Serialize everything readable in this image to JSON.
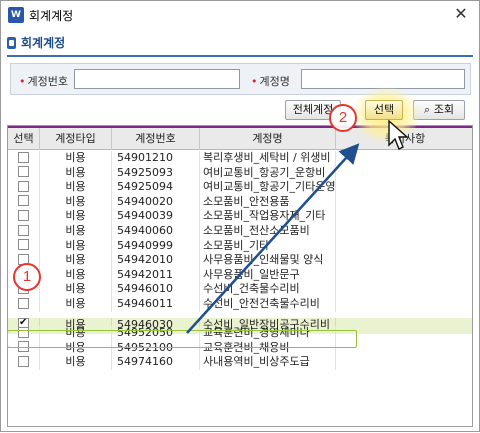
{
  "window": {
    "title": "회계계정",
    "icon_label": "W"
  },
  "page": {
    "heading": "회계계정"
  },
  "search": {
    "account_code_label": "계정번호",
    "account_code_value": "",
    "account_name_label": "계정명",
    "account_name_value": ""
  },
  "toolbar": {
    "select_all_label": "전체계정",
    "select_label": "선택",
    "search_label": "조회"
  },
  "table": {
    "columns": [
      "선택",
      "계정타입",
      "계정번호",
      "계정명",
      "특이사항"
    ],
    "rows": [
      {
        "checked": false,
        "type": "비용",
        "code": "54901210",
        "name": "복리후생비_세탁비 / 위생비"
      },
      {
        "checked": false,
        "type": "비용",
        "code": "54925093",
        "name": "여비교통비_항공기_운항비"
      },
      {
        "checked": false,
        "type": "비용",
        "code": "54925094",
        "name": "여비교통비_항공기_기타운영"
      },
      {
        "checked": false,
        "type": "비용",
        "code": "54940020",
        "name": "소모품비_안전용품"
      },
      {
        "checked": false,
        "type": "비용",
        "code": "54940039",
        "name": "소모품비_작업용자재_기타"
      },
      {
        "checked": false,
        "type": "비용",
        "code": "54940060",
        "name": "소모품비_전산소모품비"
      },
      {
        "checked": false,
        "type": "비용",
        "code": "54940999",
        "name": "소모품비_기타"
      },
      {
        "checked": false,
        "type": "비용",
        "code": "54942010",
        "name": "사무용품비_인쇄물및 양식"
      },
      {
        "checked": false,
        "type": "비용",
        "code": "54942011",
        "name": "사무용품비_일반문구"
      },
      {
        "checked": false,
        "type": "비용",
        "code": "54946010",
        "name": "수선비_건축물수리비"
      },
      {
        "checked": false,
        "type": "비용",
        "code": "54946011",
        "name": "수선비_안전건축물수리비"
      },
      {
        "checked": true,
        "type": "비용",
        "code": "54946030",
        "name": "수선비_일반장비공구수리비"
      },
      {
        "checked": false,
        "type": "비용",
        "code": "54952050",
        "name": "교육훈련비_경영세미나"
      },
      {
        "checked": false,
        "type": "비용",
        "code": "54952100",
        "name": "교육훈련비_채용비"
      },
      {
        "checked": false,
        "type": "비용",
        "code": "54974160",
        "name": "사내용역비_비상주도급"
      }
    ]
  },
  "annotations": {
    "marker_1": "1",
    "marker_2": "2"
  },
  "colors": {
    "accent": "#3b6fb3",
    "marker": "#e8352e",
    "selected_row": "#eaf3d0",
    "arrow": "#1f4f8f"
  }
}
